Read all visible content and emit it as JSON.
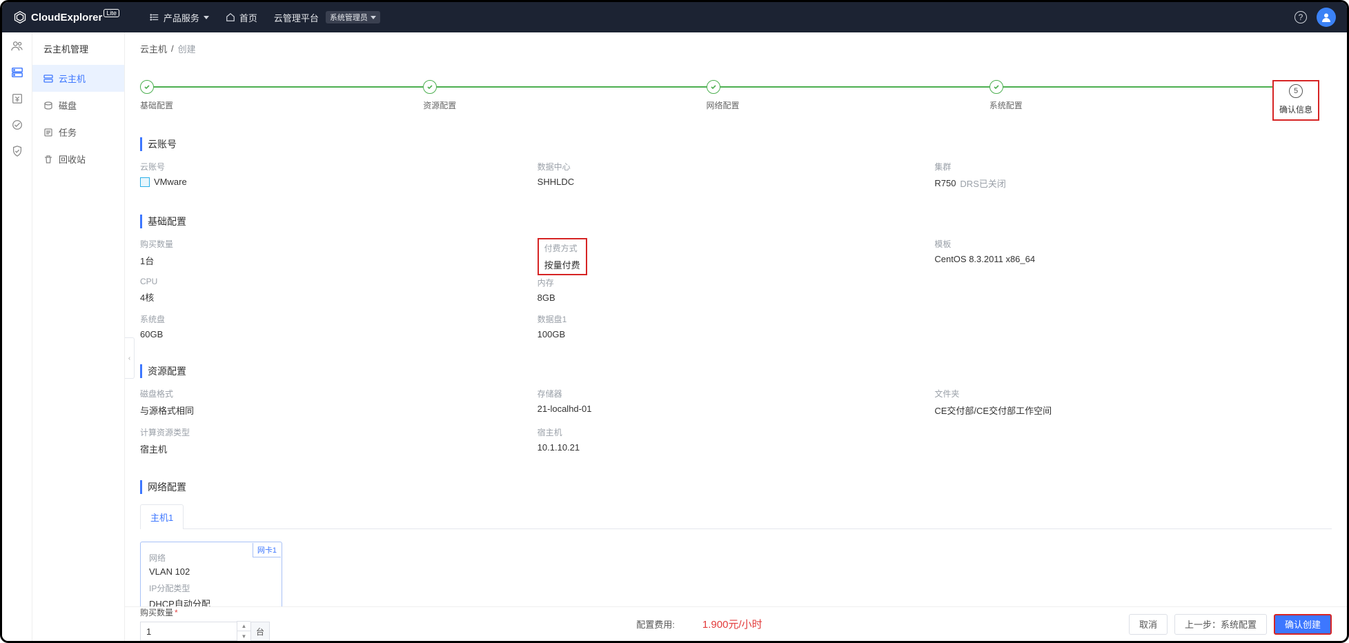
{
  "brand": {
    "name": "CloudExplorer",
    "lite": "Lite"
  },
  "topnav": {
    "product_services": "产品服务",
    "home": "首页",
    "platform": "云管理平台",
    "role": "系统管理员"
  },
  "sidebar": {
    "title": "云主机管理",
    "items": [
      {
        "label": "云主机",
        "icon": "server-icon"
      },
      {
        "label": "磁盘",
        "icon": "disk-icon"
      },
      {
        "label": "任务",
        "icon": "task-icon"
      },
      {
        "label": "回收站",
        "icon": "trash-icon"
      }
    ]
  },
  "breadcrumb": {
    "root": "云主机",
    "current": "创建"
  },
  "steps": [
    {
      "label": "基础配置"
    },
    {
      "label": "资源配置"
    },
    {
      "label": "网络配置"
    },
    {
      "label": "系统配置"
    },
    {
      "label": "确认信息",
      "num": "5"
    }
  ],
  "sections": {
    "account": {
      "title": "云账号",
      "rows": [
        [
          {
            "label": "云账号",
            "value": "VMware",
            "icon": true
          },
          {
            "label": "数据中心",
            "value": "SHHLDC"
          },
          {
            "label": "集群",
            "value": "R750",
            "suffix": "DRS已关闭"
          }
        ]
      ]
    },
    "basic": {
      "title": "基础配置",
      "rows": [
        [
          {
            "label": "购买数量",
            "value": "1台"
          },
          {
            "label": "付费方式",
            "value": "按量付费",
            "highlight": true
          },
          {
            "label": "模板",
            "value": "CentOS 8.3.2011 x86_64"
          }
        ],
        [
          {
            "label": "CPU",
            "value": "4核"
          },
          {
            "label": "内存",
            "value": "8GB"
          },
          {
            "label": "",
            "value": ""
          }
        ],
        [
          {
            "label": "系统盘",
            "value": "60GB"
          },
          {
            "label": "数据盘1",
            "value": "100GB"
          },
          {
            "label": "",
            "value": ""
          }
        ]
      ]
    },
    "resource": {
      "title": "资源配置",
      "rows": [
        [
          {
            "label": "磁盘格式",
            "value": "与源格式相同"
          },
          {
            "label": "存储器",
            "value": "21-localhd-01"
          },
          {
            "label": "文件夹",
            "value": "CE交付部/CE交付部工作空间"
          }
        ],
        [
          {
            "label": "计算资源类型",
            "value": "宿主机"
          },
          {
            "label": "宿主机",
            "value": "10.1.10.21"
          },
          {
            "label": "",
            "value": ""
          }
        ]
      ]
    },
    "network": {
      "title": "网络配置",
      "host_tab": "主机1",
      "card": {
        "badge": "网卡1",
        "net_label": "网络",
        "net_value": "VLAN 102",
        "ip_label": "IP分配类型",
        "ip_value": "DHCP自动分配"
      }
    }
  },
  "footbar": {
    "qty_label": "购买数量",
    "qty_value": "1",
    "qty_unit": "台",
    "cost_label": "配置费用:",
    "cost_value": "1.900元/小时",
    "cancel": "取消",
    "prev": "上一步：系统配置",
    "confirm": "确认创建"
  }
}
